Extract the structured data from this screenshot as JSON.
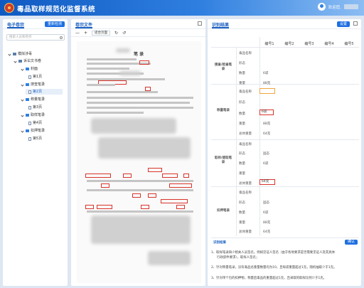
{
  "app": {
    "title": "毒品取样规范化监督系统",
    "welcome": "欢迎您,"
  },
  "left": {
    "title": "电子卷宗",
    "button": "重新检测",
    "search_placeholder": "搜索人员和卷宗",
    "tree": [
      "模拟涉毒",
      "诉讼文书卷",
      "封面",
      "第1页",
      "搜查笔录",
      "第2页",
      "称量笔录",
      "第3页",
      "取样笔录",
      "第4页",
      "扣押笔录",
      "第5页"
    ]
  },
  "mid": {
    "title": "卷宗文件",
    "zoom": "适合页面",
    "doc_heading": "笔 录"
  },
  "right": {
    "title": "识别结果",
    "settings": "设置",
    "cols": [
      "编号1",
      "编号2",
      "编号3",
      "编号4",
      "编号5"
    ],
    "sections": [
      "搜查/检查笔录",
      "称量笔录",
      "取样/提取笔录",
      "扣押笔录"
    ],
    "fields": {
      "name": "毒品名称",
      "form": "形态",
      "count": "数量",
      "weight": "重量",
      "total": "总体重量"
    },
    "values": {
      "count": "6袋",
      "weight": "88克",
      "total": "64克",
      "form": "固态"
    },
    "results_title": "识别结果",
    "confirm": "确认",
    "results": [
      "1、取样笔录缺少相关人员签名，例如见证人签名（由于各地要求是否需要见证人及其具体",
      "行政部件要求），取样人签名；",
      "2、针对称量笔录，没有毒品总重量数量均为10，且每袋重量超过1克，随机抽取少于1克。",
      "3、针对单个包的扣押物，称量后毒品的重量超过1克，且采取的取样比例少于1克。"
    ]
  }
}
